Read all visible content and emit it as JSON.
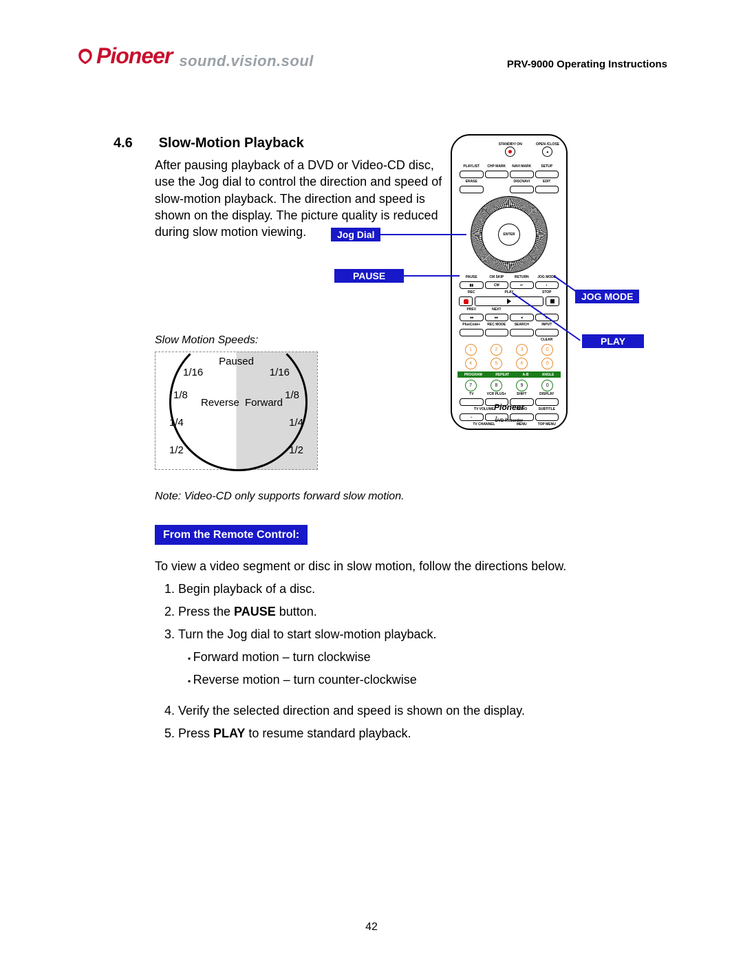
{
  "header": {
    "brand": "Pioneer",
    "tagline": "sound.vision.soul",
    "doc_title": "PRV-9000 Operating Instructions"
  },
  "section": {
    "number": "4.6",
    "title": "Slow-Motion Playback"
  },
  "intro": "After pausing playback of a DVD or Video-CD disc, use the Jog dial to control the direction and speed of slow-motion playback. The direction and speed is shown on the display. The picture quality is reduced during slow motion viewing.",
  "callouts": {
    "jog_dial": "Jog Dial",
    "pause": "PAUSE",
    "jog_mode": "JOG MODE",
    "play": "PLAY"
  },
  "speeds": {
    "heading": "Slow Motion Speeds:",
    "top": "Paused",
    "left_label": "Reverse",
    "right_label": "Forward",
    "left": [
      "1/16",
      "1/8",
      "1/4",
      "1/2"
    ],
    "right": [
      "1/16",
      "1/8",
      "1/4",
      "1/2"
    ]
  },
  "note": "Note: Video-CD only supports forward slow motion.",
  "from_remote_heading": "From the Remote Control:",
  "lead": "To view a video segment or disc in slow motion, follow the directions below.",
  "steps": {
    "s1": "Begin playback of a disc.",
    "s2_pre": "Press the ",
    "s2_bold": "PAUSE",
    "s2_post": " button.",
    "s3": "Turn the Jog dial to start slow-motion playback.",
    "s3a": "Forward motion – turn clockwise",
    "s3b": "Reverse motion – turn counter-clockwise",
    "s4": "Verify the selected direction and speed is shown on the display.",
    "s5_pre": "Press ",
    "s5_bold": "PLAY",
    "s5_post": " to resume standard playback."
  },
  "remote": {
    "standby": "STANDBY/ ON",
    "open": "OPEN /CLOSE",
    "row1": [
      "PLAYLIST",
      "CHP MARK",
      "NAVI MARK",
      "SETUP"
    ],
    "row2": [
      "ERASE",
      "",
      "DISCNAVI",
      "EDIT"
    ],
    "enter": "ENTER",
    "row_trans": [
      "PAUSE",
      "CM SKIP",
      "RETURN",
      "JOG MODE"
    ],
    "row_rec": [
      "REC",
      "PLAY",
      "STOP"
    ],
    "row_prev": [
      "PREV",
      "NEXT",
      "",
      ""
    ],
    "row_misc": [
      "PlusCode+",
      "REC MODE",
      "SEARCH",
      "INPUT"
    ],
    "clear": "CLEAR",
    "nums": [
      "1",
      "2",
      "3",
      "C",
      "4",
      "5",
      "6",
      "0",
      "7",
      "8",
      "9",
      "0"
    ],
    "strip": [
      "PROGRAM",
      "REPEAT",
      "A-B",
      "ANGLE"
    ],
    "row_tv1": [
      "TV",
      "VCR PLUS+",
      "SHIFT",
      "DISPLAY"
    ],
    "row_tv2": [
      "TV VOLUME",
      "",
      "AUDIO",
      "SUBTITLE"
    ],
    "row_tv3": [
      "TV CHANNEL",
      "",
      "MENU",
      "TOP MENU"
    ],
    "brand": "Pioneer",
    "sub": "DVD Recorder"
  },
  "page_number": "42"
}
